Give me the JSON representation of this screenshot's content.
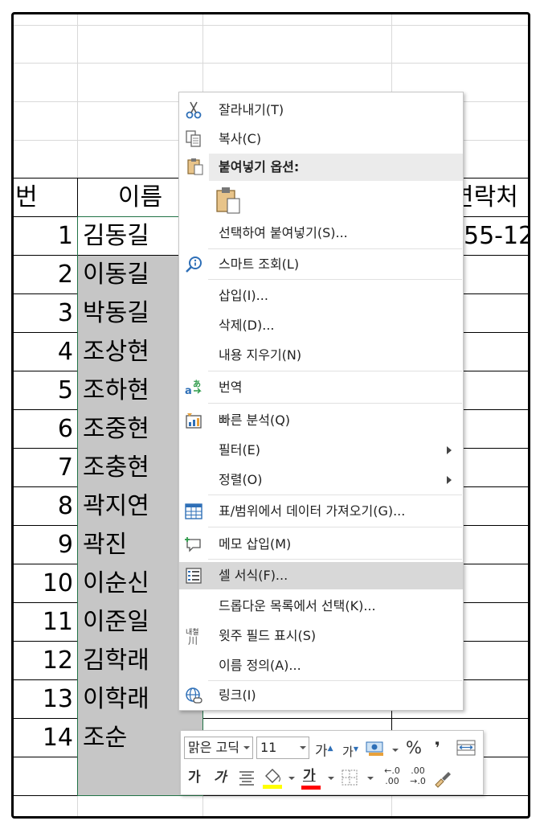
{
  "sheet": {
    "header": {
      "col_a": "번",
      "col_b": "이름",
      "col_d": "연락처"
    },
    "partial_phone": "55-12",
    "rows": [
      {
        "no": "1",
        "name": "김동길"
      },
      {
        "no": "2",
        "name": "이동길"
      },
      {
        "no": "3",
        "name": "박동길"
      },
      {
        "no": "4",
        "name": "조상현"
      },
      {
        "no": "5",
        "name": "조하현"
      },
      {
        "no": "6",
        "name": "조중현"
      },
      {
        "no": "7",
        "name": "조충현"
      },
      {
        "no": "8",
        "name": "곽지연"
      },
      {
        "no": "9",
        "name": "곽진"
      },
      {
        "no": "10",
        "name": "이순신"
      },
      {
        "no": "11",
        "name": "이준일"
      },
      {
        "no": "12",
        "name": "김학래"
      },
      {
        "no": "13",
        "name": "이학래"
      },
      {
        "no": "14",
        "name": "조순"
      }
    ]
  },
  "context_menu": {
    "cut": "잘라내기(T)",
    "copy": "복사(C)",
    "paste_options_header": "붙여넣기 옵션:",
    "paste_special": "선택하여 붙여넣기(S)...",
    "smart_lookup": "스마트 조회(L)",
    "insert": "삽입(I)...",
    "delete": "삭제(D)...",
    "clear_contents": "내용 지우기(N)",
    "translate": "번역",
    "quick_analysis": "빠른 분석(Q)",
    "filter": "필터(E)",
    "sort": "정렬(O)",
    "get_data": "표/범위에서 데이터 가져오기(G)...",
    "insert_comment": "메모 삽입(M)",
    "format_cells": "셀 서식(F)...",
    "pick_list": "드롭다운 목록에서 선택(K)...",
    "phonetic": "윗주 필드 표시(S)",
    "define_name": "이름 정의(A)...",
    "link": "링크(I)"
  },
  "mini_toolbar": {
    "font_name": "맑은 고딕",
    "font_size": "11",
    "grow_font": "가",
    "shrink_font": "가",
    "percent": "%",
    "comma": "❜",
    "bold": "가",
    "italic": "가",
    "font_color_glyph": "가",
    "inc_decimal_top": "←.0",
    "inc_decimal_bottom": ".00",
    "dec_decimal_top": ".00",
    "dec_decimal_bottom": "→.0"
  },
  "colors": {
    "selection_fill": "#c6c6c6",
    "selection_border": "#217346",
    "menu_highlight": "#d8d8d8",
    "fill_color_bar": "#ffff00",
    "font_color_bar": "#ff0000"
  }
}
